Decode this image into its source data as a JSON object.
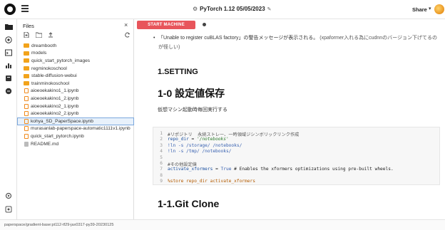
{
  "header": {
    "notebook_title": "PyTorch 1.12 05/05/2023",
    "share_label": "Share",
    "share_chevron": "▾",
    "title_icon": "⚙",
    "edit_icon": "✎"
  },
  "rail": {
    "icons": [
      "folder-icon",
      "lightning-icon",
      "terminal-icon",
      "chart-icon",
      "storage-icon",
      "code-icon",
      "settings-icon",
      "help-icon"
    ]
  },
  "files": {
    "title": "Files",
    "close": "×",
    "items": [
      {
        "type": "folder",
        "name": "dreambooth"
      },
      {
        "type": "folder",
        "name": "models"
      },
      {
        "type": "folder",
        "name": "quick_start_pytorch_images"
      },
      {
        "type": "folder",
        "name": "regminokoschool"
      },
      {
        "type": "folder",
        "name": "stable-diffusion-webui"
      },
      {
        "type": "folder",
        "name": "trainminokoschool"
      },
      {
        "type": "notebook",
        "name": "aioeoekakino1_1.ipynb"
      },
      {
        "type": "notebook",
        "name": "aioeoekakino1_2.ipynb"
      },
      {
        "type": "notebook",
        "name": "aioeoekakino2_1.ipynb"
      },
      {
        "type": "notebook",
        "name": "aioeoekakino2_2.ipynb"
      },
      {
        "type": "notebook",
        "name": "kohya_SD_PaperSpace.ipynb",
        "selected": true
      },
      {
        "type": "notebook",
        "name": "murasanlab-paperspace-automatic1111v1.ipynb"
      },
      {
        "type": "notebook",
        "name": "quick_start_pytorch.ipynb"
      },
      {
        "type": "markdown",
        "name": "README.md"
      }
    ]
  },
  "main": {
    "start_button": "START MACHINE",
    "warning_text": "「Unable to register cuBLAS factory」の警告メッセージが表示される。",
    "warning_note": "(xpaformer入れる為にcudnnのバージョン下げてるのが怪しい)",
    "heading_setting": "1.SETTING",
    "heading_save": "1-0 設定値保存",
    "paragraph": "仮想マシン起動時毎回実行する",
    "heading_git": "1-1.Git Clone",
    "code": [
      {
        "n": "1",
        "parts": [
          {
            "c": "c-com",
            "t": "#リポジトリ  永続ストレー、一時領域ジシンボリックリンク作成"
          }
        ]
      },
      {
        "n": "2",
        "parts": [
          {
            "c": "c-var",
            "t": "repo_dir"
          },
          {
            "c": "",
            "t": " = "
          },
          {
            "c": "c-str",
            "t": "'/notebooks'"
          }
        ]
      },
      {
        "n": "3",
        "parts": [
          {
            "c": "c-kw",
            "t": "!ln -s /storage/ /notebooks/"
          }
        ]
      },
      {
        "n": "4",
        "parts": [
          {
            "c": "c-kw",
            "t": "!ln -s /tmp/ /notebooks/"
          }
        ]
      },
      {
        "n": "5",
        "parts": [
          {
            "c": "",
            "t": ""
          }
        ]
      },
      {
        "n": "6",
        "parts": [
          {
            "c": "c-com",
            "t": "#その他設定値"
          }
        ]
      },
      {
        "n": "7",
        "parts": [
          {
            "c": "c-var",
            "t": "activate_xformers"
          },
          {
            "c": "",
            "t": " = "
          },
          {
            "c": "c-kw",
            "t": "True"
          },
          {
            "c": "",
            "t": " # Enables the xformers optimizations using pre-built wheels."
          }
        ]
      },
      {
        "n": "8",
        "parts": [
          {
            "c": "",
            "t": ""
          }
        ]
      },
      {
        "n": "9",
        "parts": [
          {
            "c": "c-mag",
            "t": "%store repo_dir activate_xformers"
          }
        ]
      }
    ]
  },
  "statusbar": {
    "text": "paperspace/gradient-base:pt112-tf29-jax0317-py39-20230125"
  }
}
